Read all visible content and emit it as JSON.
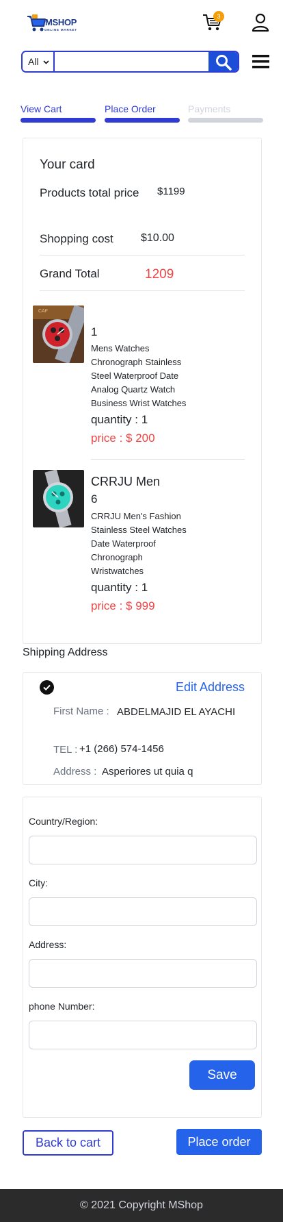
{
  "header": {
    "logo_text": "MSHOP",
    "logo_sub": "ONLINE MARKET",
    "cart_count": "3"
  },
  "search": {
    "category": "All",
    "placeholder": ""
  },
  "steps": [
    {
      "label": "View Cart",
      "state": "done"
    },
    {
      "label": "Place Order",
      "state": "active"
    },
    {
      "label": "Payments",
      "state": "pending"
    }
  ],
  "summary": {
    "title": "Your card",
    "products_total_label": "Products total price",
    "products_total_value": "$1199",
    "shipping_label": "Shopping cost",
    "shipping_value": "$10.00",
    "grand_total_label": "Grand Total",
    "grand_total_value": "1209"
  },
  "items": [
    {
      "name": "1",
      "description": "Mens Watches Chronograph Stainless Steel Waterproof Date Analog Quartz Watch Business Wrist Watches",
      "quantity": "quantity : 1",
      "price": "price : $ 200"
    },
    {
      "name": "CRRJU Men",
      "subname": "6",
      "description": "CRRJU Men's Fashion Stainless Steel Watches Date Waterproof Chronograph Wristwatches",
      "quantity": "quantity : 1",
      "price": "price : $ 999"
    }
  ],
  "shipping": {
    "section_title": "Shipping Address",
    "edit_label": "Edit Address",
    "first_name_label": "First Name :",
    "first_name_value": "ABDELMAJID EL AYACHI",
    "tel_label": "TEL :",
    "tel_value": "+1 (266) 574-1456",
    "address_label": "Address :",
    "address_value": "Asperiores ut quia q"
  },
  "form": {
    "country_label": "Country/Region:",
    "city_label": "City:",
    "address_label": "Address:",
    "phone_label": "phone Number:",
    "save_label": "Save"
  },
  "actions": {
    "back_label": "Back to cart",
    "place_label": "Place order"
  },
  "footer": {
    "text": "© 2021 Copyright MShop"
  },
  "colors": {
    "primary": "#2f3bd3",
    "button": "#2563eb",
    "price_red": "#ef4444",
    "step_pending": "#d1d5db",
    "footer_bg": "#2b2b2b"
  }
}
